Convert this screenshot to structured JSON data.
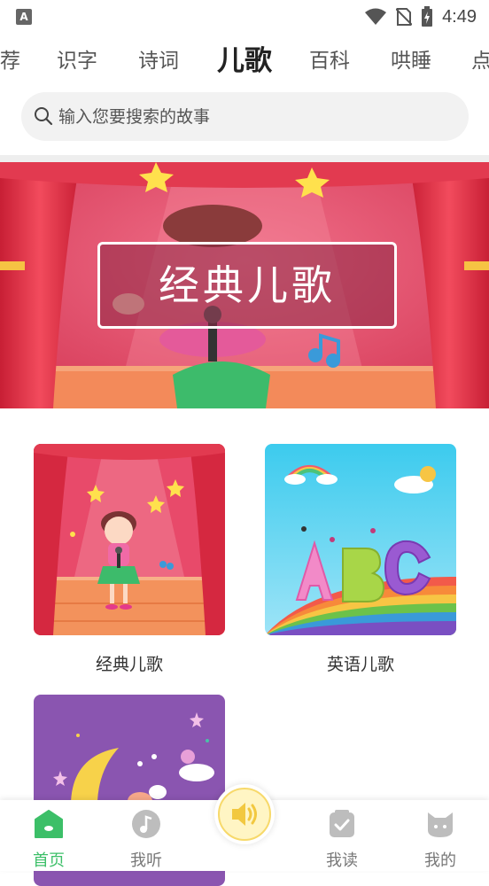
{
  "status_bar": {
    "time": "4:49",
    "app_icon_letter": "A"
  },
  "tabs": [
    {
      "label": "荐",
      "active": false
    },
    {
      "label": "识字",
      "active": false
    },
    {
      "label": "诗词",
      "active": false
    },
    {
      "label": "儿歌",
      "active": true
    },
    {
      "label": "百科",
      "active": false
    },
    {
      "label": "哄睡",
      "active": false
    },
    {
      "label": "点",
      "active": false
    }
  ],
  "search": {
    "placeholder": "输入您要搜索的故事"
  },
  "banner": {
    "title": "经典儿歌"
  },
  "cards": [
    {
      "label": "经典儿歌"
    },
    {
      "label": "英语儿歌"
    },
    {
      "label": ""
    }
  ],
  "bottom_nav": [
    {
      "label": "首页",
      "icon": "home-icon",
      "active": true
    },
    {
      "label": "我听",
      "icon": "music-note-icon",
      "active": false
    },
    {
      "label": "",
      "icon": "speaker-icon",
      "active": false
    },
    {
      "label": "我读",
      "icon": "book-check-icon",
      "active": false
    },
    {
      "label": "我的",
      "icon": "cat-face-icon",
      "active": false
    }
  ],
  "colors": {
    "accent": "#3cbf68",
    "stage_red": "#e8485e",
    "speaker_yellow": "#f7d96a"
  }
}
